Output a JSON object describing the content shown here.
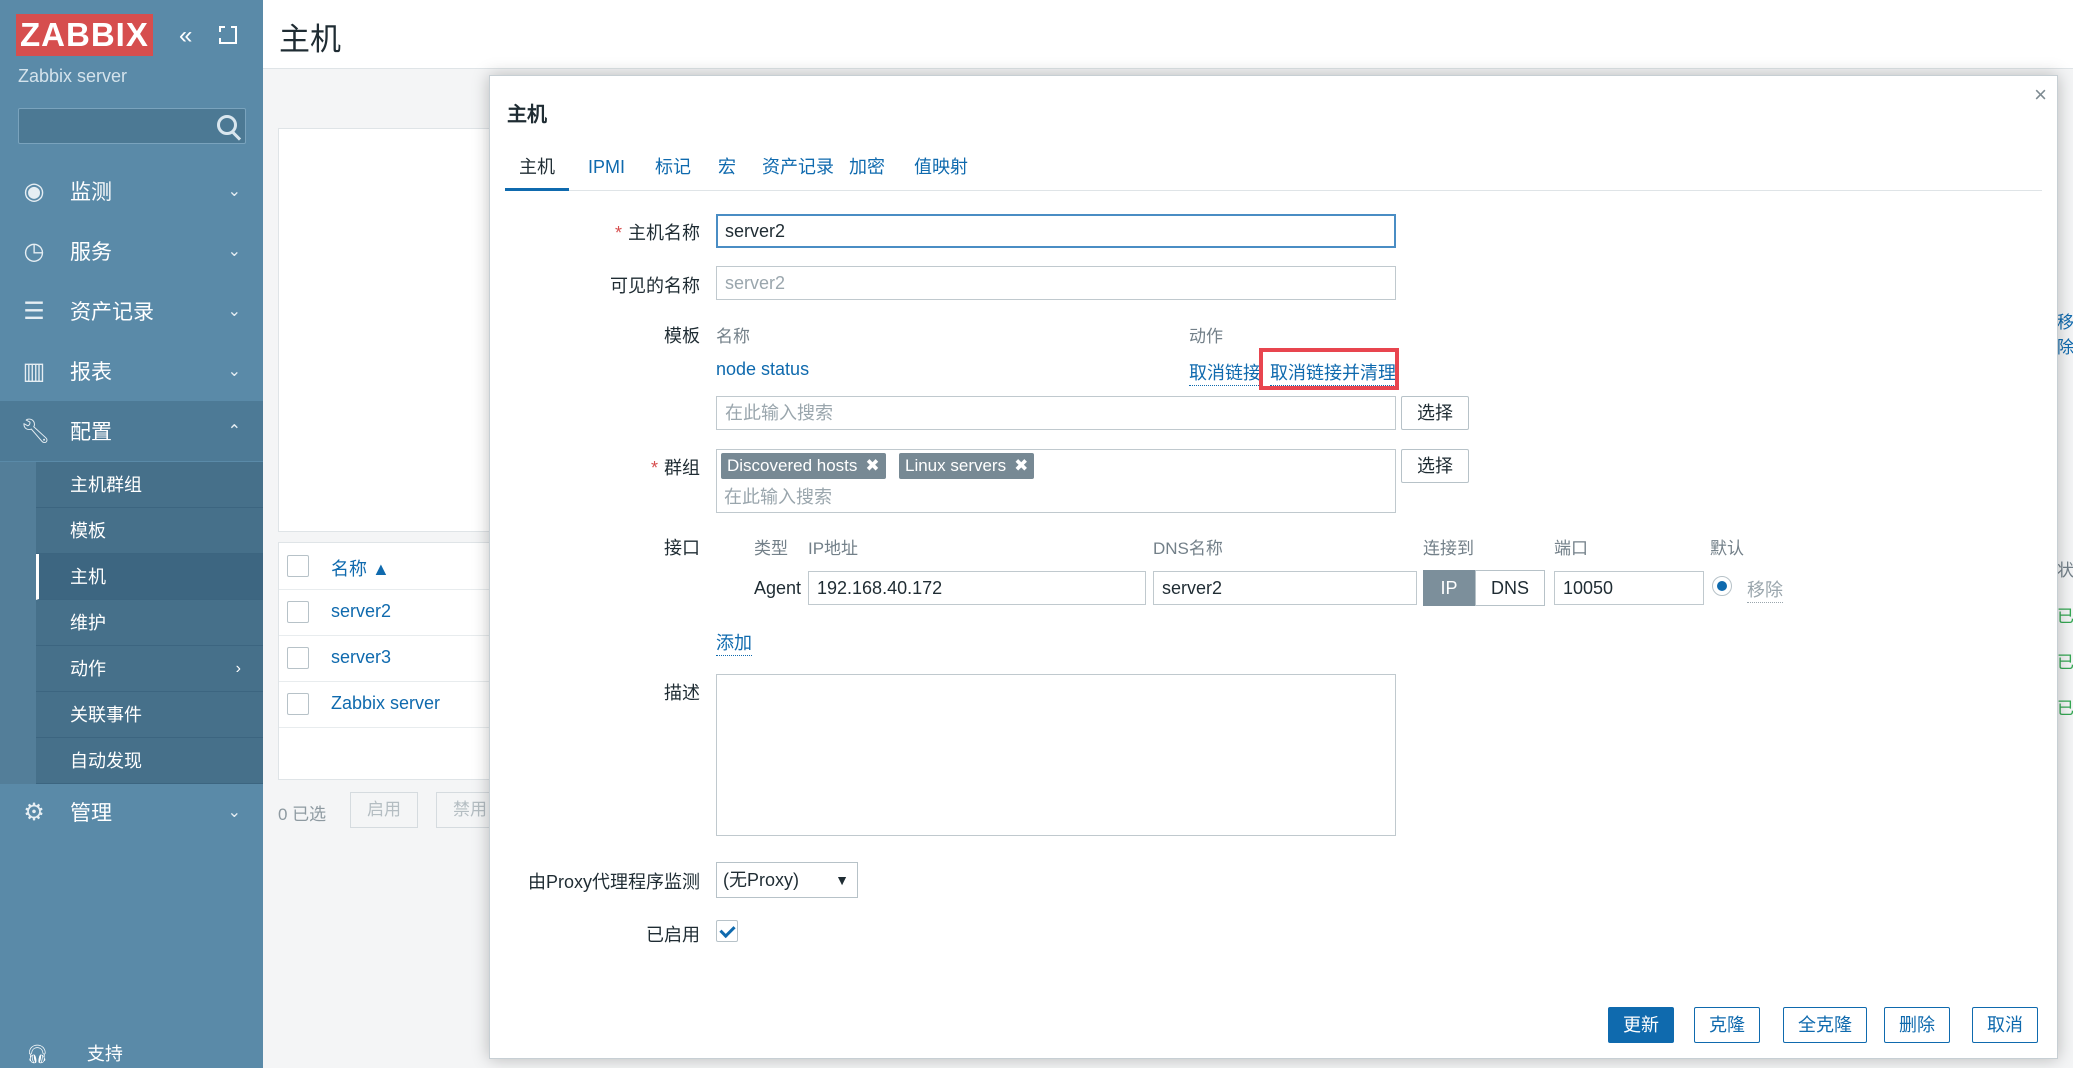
{
  "sidebar": {
    "logo": "ZABBIX",
    "server_name": "Zabbix server",
    "menu": [
      {
        "label": "监测"
      },
      {
        "label": "服务"
      },
      {
        "label": "资产记录"
      },
      {
        "label": "报表"
      },
      {
        "label": "配置"
      },
      {
        "label": "管理"
      }
    ],
    "submenu": [
      "主机群组",
      "模板",
      "主机",
      "维护",
      "动作",
      "关联事件",
      "自动发现"
    ],
    "support": "支持"
  },
  "page": {
    "title": "主机",
    "list_header": "名称 ▲",
    "rows": [
      "server2",
      "server3",
      "Zabbix server"
    ],
    "selected": "0 已选",
    "btn_enable": "启用",
    "btn_disable": "禁用",
    "edge_right": "移除",
    "edge_status": "状",
    "edge_enabled": "已"
  },
  "modal": {
    "title": "主机",
    "tabs": [
      "主机",
      "IPMI",
      "标记",
      "宏",
      "资产记录",
      "加密",
      "值映射"
    ],
    "host_name_label": "主机名称",
    "host_name": "server2",
    "visible_name_label": "可见的名称",
    "visible_name_placeholder": "server2",
    "templates_label": "模板",
    "templates_col_name": "名称",
    "templates_col_action": "动作",
    "template_name": "node status",
    "unlink": "取消链接",
    "unlink_clear": "取消链接并清理",
    "search_placeholder": "在此输入搜索",
    "select_btn": "选择",
    "groups_label": "群组",
    "groups": [
      "Discovered hosts",
      "Linux servers"
    ],
    "interfaces_label": "接口",
    "if_cols": [
      "类型",
      "IP地址",
      "DNS名称",
      "连接到",
      "端口",
      "默认"
    ],
    "if_type": "Agent",
    "if_ip": "192.168.40.172",
    "if_dns": "server2",
    "if_conn_ip": "IP",
    "if_conn_dns": "DNS",
    "if_port": "10050",
    "if_remove": "移除",
    "add": "添加",
    "description_label": "描述",
    "proxy_label": "由Proxy代理程序监测",
    "proxy_value": "(无Proxy)",
    "enabled_label": "已启用",
    "buttons": [
      "更新",
      "克隆",
      "全克隆",
      "删除",
      "取消"
    ]
  }
}
